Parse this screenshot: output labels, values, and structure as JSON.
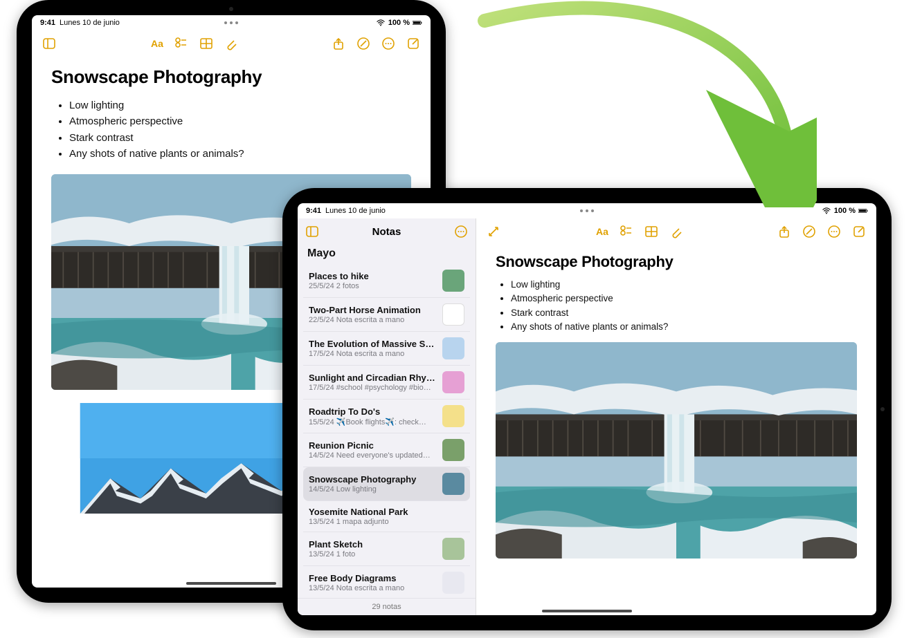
{
  "status": {
    "time": "9:41",
    "date": "Lunes 10 de junio",
    "battery": "100 %"
  },
  "note": {
    "title": "Snowscape Photography",
    "bullets": [
      "Low lighting",
      "Atmospheric perspective",
      "Stark contrast",
      "Any shots of native plants or animals?"
    ]
  },
  "sidebar": {
    "app_title": "Notas",
    "month": "Mayo",
    "count_label": "29 notas",
    "items": [
      {
        "title": "Places to hike",
        "date": "25/5/24",
        "sub": "2 fotos",
        "thumb": "#6aa57a"
      },
      {
        "title": "Two-Part Horse Animation",
        "date": "22/5/24",
        "sub": "Nota escrita a mano",
        "thumb": "#ffffff"
      },
      {
        "title": "The Evolution of Massive Star…",
        "date": "17/5/24",
        "sub": "Nota escrita a mano",
        "thumb": "#b8d4ee"
      },
      {
        "title": "Sunlight and Circadian Rhyth…",
        "date": "17/5/24",
        "sub": "#school #psychology #bio…",
        "thumb": "#e6a0d4"
      },
      {
        "title": "Roadtrip To Do's",
        "date": "15/5/24",
        "sub": "✈️Book flights✈️: check…",
        "thumb": "#f4e08a"
      },
      {
        "title": "Reunion Picnic",
        "date": "14/5/24",
        "sub": "Need everyone's updated…",
        "thumb": "#7aa06a"
      },
      {
        "title": "Snowscape Photography",
        "date": "14/5/24",
        "sub": "Low lighting",
        "thumb": "#5a8aa0",
        "selected": true
      },
      {
        "title": "Yosemite National Park",
        "date": "13/5/24",
        "sub": "1 mapa adjunto",
        "thumb": ""
      },
      {
        "title": "Plant Sketch",
        "date": "13/5/24",
        "sub": "1 foto",
        "thumb": "#a8c49a"
      },
      {
        "title": "Free Body Diagrams",
        "date": "13/5/24",
        "sub": "Nota escrita a mano",
        "thumb": "#e8e8f0"
      }
    ]
  }
}
